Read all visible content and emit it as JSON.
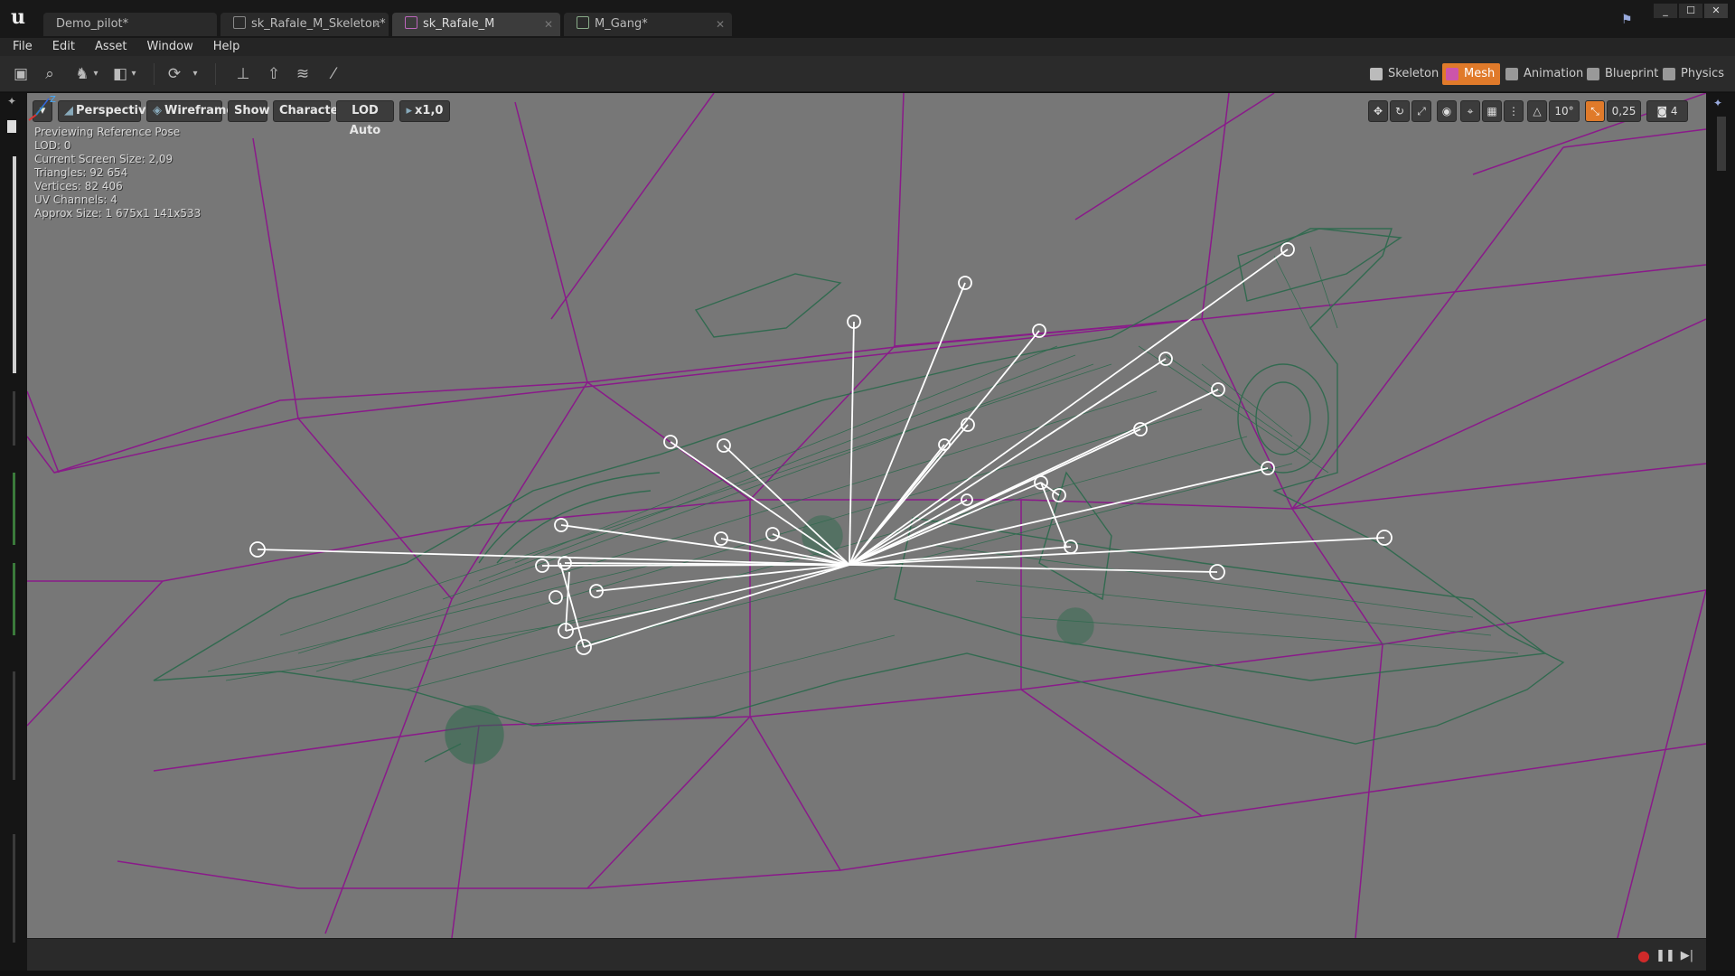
{
  "app": {
    "logo": "u"
  },
  "tabs": [
    {
      "label": "Demo_pilot*",
      "icon": "map-icon"
    },
    {
      "label": "sk_Rafale_M_Skeleton*",
      "icon": "skeleton-icon"
    },
    {
      "label": "sk_Rafale_M",
      "icon": "mesh-icon"
    },
    {
      "label": "M_Gang*",
      "icon": "material-icon"
    }
  ],
  "window": {
    "minimize": "_",
    "maximize": "☐",
    "close": "✕"
  },
  "menu": [
    "File",
    "Edit",
    "Asset",
    "Window",
    "Help"
  ],
  "toolbar": {
    "icons": [
      "save-icon",
      "find-in-browser-icon",
      "character-icon",
      "camera-icon",
      "reimport-icon",
      "skeleton-tree-icon",
      "upload-icon",
      "layers-icon",
      "brush-icon"
    ],
    "modes": [
      {
        "label": "Skeleton",
        "active": false
      },
      {
        "label": "Mesh",
        "active": true
      },
      {
        "label": "Animation",
        "active": false
      },
      {
        "label": "Blueprint",
        "active": false
      },
      {
        "label": "Physics",
        "active": false
      }
    ]
  },
  "viewport": {
    "buttons": {
      "options": "▾",
      "perspective": "Perspective",
      "wireframe": "Wireframe",
      "show": "Show",
      "character": "Character",
      "lod": "LOD Auto",
      "speed": "x1,0"
    },
    "right_controls": {
      "rotation_snap": "10°",
      "scale_snap": "0,25",
      "camera_speed": "4"
    },
    "stats": [
      "Previewing Reference Pose",
      "LOD: 0",
      "Current Screen Size: 2,09",
      "Triangles: 92 654",
      "Vertices: 82 406",
      "UV Channels: 4",
      "Approx Size: 1 675x1 141x533"
    ],
    "axis": {
      "z": "Z"
    }
  },
  "playback": {
    "record": "●",
    "pause": "❚❚",
    "step": "▶|"
  },
  "colors": {
    "viewport_bg": "#777777",
    "grid": "#8a1a8a",
    "wireframe": "#2f6a4e",
    "bones": "#ffffff",
    "accent": "#e07a2a"
  }
}
